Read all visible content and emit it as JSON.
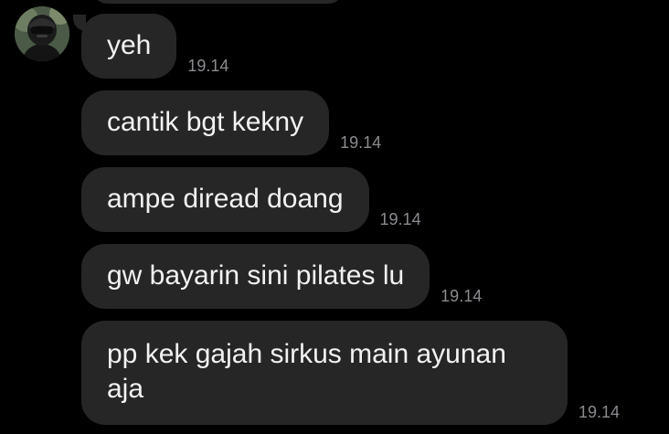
{
  "conversation": {
    "messages": [
      {
        "text": "yeh",
        "time": "19.14"
      },
      {
        "text": "cantik bgt kekny",
        "time": "19.14"
      },
      {
        "text": "ampe diread doang",
        "time": "19.14"
      },
      {
        "text": "gw bayarin sini pilates lu",
        "time": "19.14"
      },
      {
        "text": "pp kek gajah sirkus main ayunan aja",
        "time": "19.14"
      }
    ]
  },
  "colors": {
    "background": "#000000",
    "bubble": "#262627",
    "text": "#f2f2f3",
    "timestamp": "#8b8b90"
  },
  "icons": {
    "avatar": "user-avatar-helmet-photo"
  }
}
